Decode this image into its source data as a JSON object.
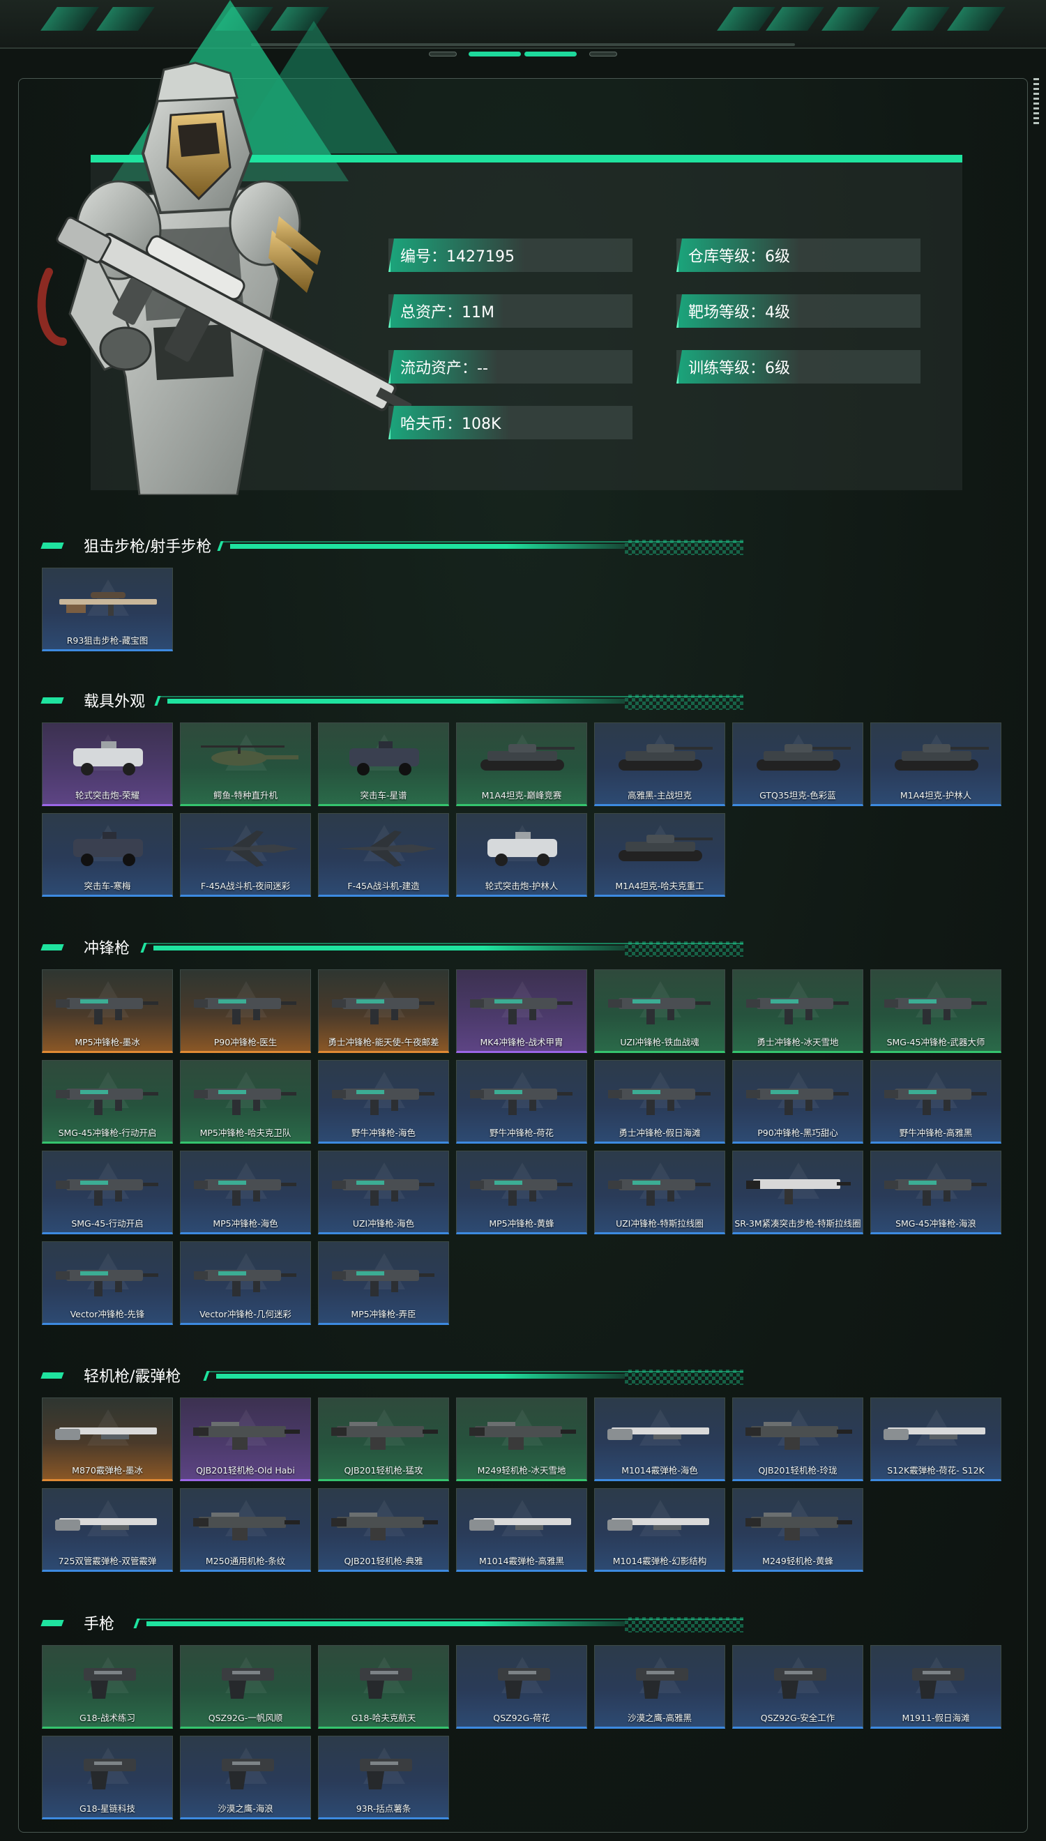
{
  "profile": {
    "stats": [
      {
        "label": "编号：1427195"
      },
      {
        "label": "仓库等级：6级"
      },
      {
        "label": "总资产：11M"
      },
      {
        "label": "靶场等级：4级"
      },
      {
        "label": "流动资产：--"
      },
      {
        "label": "训练等级：6级"
      },
      {
        "label": "哈夫币：108K"
      }
    ]
  },
  "sections": [
    {
      "title": "狙击步枪/射手步枪",
      "items": [
        {
          "name": "R93狙击步枪-藏宝图",
          "rarity": "blue",
          "icon": "sniper-rifle-icon"
        }
      ]
    },
    {
      "title": "载具外观",
      "items": [
        {
          "name": "轮式突击炮-荣耀",
          "rarity": "purple",
          "icon": "armored-car-icon"
        },
        {
          "name": "鳄鱼-特种直升机",
          "rarity": "green",
          "icon": "helicopter-icon"
        },
        {
          "name": "突击车-星谱",
          "rarity": "green",
          "icon": "assault-vehicle-icon"
        },
        {
          "name": "M1A4坦克-巅峰竞赛",
          "rarity": "green",
          "icon": "tank-icon"
        },
        {
          "name": "高雅黑-主战坦克",
          "rarity": "blue",
          "icon": "tank-icon"
        },
        {
          "name": "GTQ35坦克-色彩蓝",
          "rarity": "blue",
          "icon": "tank-icon"
        },
        {
          "name": "M1A4坦克-护林人",
          "rarity": "blue",
          "icon": "tank-icon"
        },
        {
          "name": "突击车-寒梅",
          "rarity": "blue",
          "icon": "assault-vehicle-icon"
        },
        {
          "name": "F-45A战斗机-夜间迷彩",
          "rarity": "blue",
          "icon": "jet-fighter-icon"
        },
        {
          "name": "F-45A战斗机-建造",
          "rarity": "blue",
          "icon": "jet-fighter-icon"
        },
        {
          "name": "轮式突击炮-护林人",
          "rarity": "blue",
          "icon": "armored-car-icon"
        },
        {
          "name": "M1A4坦克-哈夫克重工",
          "rarity": "blue",
          "icon": "tank-icon"
        }
      ]
    },
    {
      "title": "冲锋枪",
      "items": [
        {
          "name": "MP5冲锋枪-墨冰",
          "rarity": "orange",
          "icon": "smg-icon"
        },
        {
          "name": "P90冲锋枪-医生",
          "rarity": "orange",
          "icon": "smg-icon"
        },
        {
          "name": "勇士冲锋枪-能天使-午夜邮差",
          "rarity": "orange",
          "icon": "smg-icon"
        },
        {
          "name": "MK4冲锋枪-战术甲胄",
          "rarity": "purple",
          "icon": "smg-icon"
        },
        {
          "name": "UZI冲锋枪-铁血战魂",
          "rarity": "green",
          "icon": "smg-icon"
        },
        {
          "name": "勇士冲锋枪-冰天雪地",
          "rarity": "green",
          "icon": "smg-icon"
        },
        {
          "name": "SMG-45冲锋枪-武器大师",
          "rarity": "green",
          "icon": "smg-icon"
        },
        {
          "name": "SMG-45冲锋枪-行动开启",
          "rarity": "green",
          "icon": "smg-icon"
        },
        {
          "name": "MP5冲锋枪-哈夫克卫队",
          "rarity": "green",
          "icon": "smg-icon"
        },
        {
          "name": "野牛冲锋枪-海色",
          "rarity": "blue",
          "icon": "smg-icon"
        },
        {
          "name": "野牛冲锋枪-荷花",
          "rarity": "blue",
          "icon": "smg-icon"
        },
        {
          "name": "勇士冲锋枪-假日海滩",
          "rarity": "blue",
          "icon": "smg-icon"
        },
        {
          "name": "P90冲锋枪-黑巧甜心",
          "rarity": "blue",
          "icon": "smg-icon"
        },
        {
          "name": "野牛冲锋枪-高雅黑",
          "rarity": "blue",
          "icon": "smg-icon"
        },
        {
          "name": "SMG-45-行动开启",
          "rarity": "blue",
          "icon": "smg-icon"
        },
        {
          "name": "MP5冲锋枪-海色",
          "rarity": "blue",
          "icon": "smg-icon"
        },
        {
          "name": "UZI冲锋枪-海色",
          "rarity": "blue",
          "icon": "smg-icon"
        },
        {
          "name": "MP5冲锋枪-黄蜂",
          "rarity": "blue",
          "icon": "smg-icon"
        },
        {
          "name": "UZI冲锋枪-特斯拉线圈",
          "rarity": "blue",
          "icon": "smg-icon"
        },
        {
          "name": "SR-3M紧凑突击步枪-特斯拉线圈",
          "rarity": "blue",
          "icon": "rifle-icon"
        },
        {
          "name": "SMG-45冲锋枪-海浪",
          "rarity": "blue",
          "icon": "smg-icon"
        },
        {
          "name": "Vector冲锋枪-先锋",
          "rarity": "blue",
          "icon": "smg-icon"
        },
        {
          "name": "Vector冲锋枪-几何迷彩",
          "rarity": "blue",
          "icon": "smg-icon"
        },
        {
          "name": "MP5冲锋枪-弄臣",
          "rarity": "blue",
          "icon": "smg-icon"
        }
      ]
    },
    {
      "title": "轻机枪/霰弹枪",
      "items": [
        {
          "name": "M870霰弹枪-墨冰",
          "rarity": "orange",
          "icon": "shotgun-icon"
        },
        {
          "name": "QJB201轻机枪-Old Habi",
          "rarity": "purple",
          "icon": "lmg-icon"
        },
        {
          "name": "QJB201轻机枪-猛攻",
          "rarity": "green",
          "icon": "lmg-icon"
        },
        {
          "name": "M249轻机枪-冰天雪地",
          "rarity": "green",
          "icon": "lmg-icon"
        },
        {
          "name": "M1014霰弹枪-海色",
          "rarity": "blue",
          "icon": "shotgun-icon"
        },
        {
          "name": "QJB201轻机枪-玲珑",
          "rarity": "blue",
          "icon": "lmg-icon"
        },
        {
          "name": "S12K霰弹枪-荷花- S12K",
          "rarity": "blue",
          "icon": "shotgun-icon"
        },
        {
          "name": "725双管霰弹枪-双管霰弹",
          "rarity": "blue",
          "icon": "shotgun-icon"
        },
        {
          "name": "M250通用机枪-条纹",
          "rarity": "blue",
          "icon": "lmg-icon"
        },
        {
          "name": "QJB201轻机枪-典雅",
          "rarity": "blue",
          "icon": "lmg-icon"
        },
        {
          "name": "M1014霰弹枪-高雅黑",
          "rarity": "blue",
          "icon": "shotgun-icon"
        },
        {
          "name": "M1014霰弹枪-幻影结构",
          "rarity": "blue",
          "icon": "shotgun-icon"
        },
        {
          "name": "M249轻机枪-黄蜂",
          "rarity": "blue",
          "icon": "lmg-icon"
        }
      ]
    },
    {
      "title": "手枪",
      "items": [
        {
          "name": "G18-战术练习",
          "rarity": "green",
          "icon": "pistol-icon"
        },
        {
          "name": "QSZ92G-一帆风顺",
          "rarity": "green",
          "icon": "pistol-icon"
        },
        {
          "name": "G18-哈夫克航天",
          "rarity": "green",
          "icon": "pistol-icon"
        },
        {
          "name": "QSZ92G-荷花",
          "rarity": "blue",
          "icon": "pistol-icon"
        },
        {
          "name": "沙漠之鹰-高雅黑",
          "rarity": "blue",
          "icon": "pistol-icon"
        },
        {
          "name": "QSZ92G-安全工作",
          "rarity": "blue",
          "icon": "pistol-icon"
        },
        {
          "name": "M1911-假日海滩",
          "rarity": "blue",
          "icon": "pistol-icon"
        },
        {
          "name": "G18-星链科技",
          "rarity": "blue",
          "icon": "pistol-icon"
        },
        {
          "name": "沙漠之鹰-海浪",
          "rarity": "blue",
          "icon": "pistol-icon"
        },
        {
          "name": "93R-括点薯条",
          "rarity": "blue",
          "icon": "pistol-icon"
        }
      ]
    }
  ],
  "colors": {
    "accent": "#1fe39f",
    "rarity_blue": "#3d8ae0",
    "rarity_green": "#35c46e",
    "rarity_purple": "#9b66e6",
    "rarity_orange": "#e08a34"
  }
}
